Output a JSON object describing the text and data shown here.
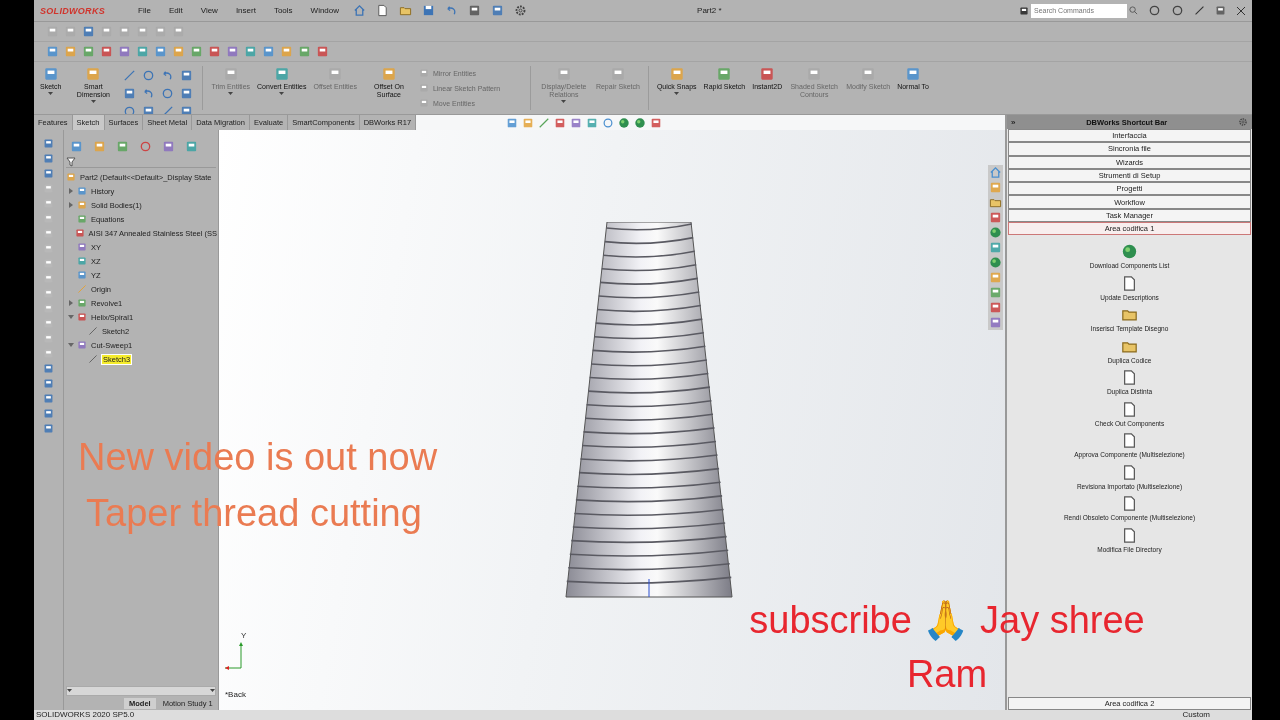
{
  "app": {
    "logo": "SOLIDWORKS",
    "menu": [
      "File",
      "Edit",
      "View",
      "Insert",
      "Tools",
      "Window"
    ],
    "document_title": "Part2 *",
    "search": {
      "placeholder": "Search Commands"
    }
  },
  "commands": [
    {
      "kind": "button",
      "label": "Sketch",
      "disabled": false,
      "caret": true
    },
    {
      "kind": "button",
      "label": "Smart Dimension",
      "disabled": false,
      "caret": true
    },
    {
      "kind": "palette"
    },
    {
      "kind": "separator"
    },
    {
      "kind": "button",
      "label": "Trim Entities",
      "disabled": true,
      "caret": true
    },
    {
      "kind": "button",
      "label": "Convert Entities",
      "disabled": false,
      "caret": true
    },
    {
      "kind": "button",
      "label": "Offset Entities",
      "disabled": true,
      "caret": false
    },
    {
      "kind": "button",
      "label": "Offset On Surface",
      "disabled": false,
      "caret": false
    },
    {
      "kind": "list",
      "items": [
        {
          "label": "Mirror Entities",
          "disabled": true
        },
        {
          "label": "Linear Sketch Pattern",
          "disabled": true
        },
        {
          "label": "Move Entities",
          "disabled": true
        }
      ]
    },
    {
      "kind": "separator"
    },
    {
      "kind": "button",
      "label": "Display/Delete Relations",
      "disabled": true,
      "caret": true
    },
    {
      "kind": "button",
      "label": "Repair Sketch",
      "disabled": true,
      "caret": false
    },
    {
      "kind": "separator"
    },
    {
      "kind": "button",
      "label": "Quick Snaps",
      "disabled": false,
      "caret": true
    },
    {
      "kind": "button",
      "label": "Rapid Sketch",
      "disabled": false,
      "caret": false
    },
    {
      "kind": "button",
      "label": "Instant2D",
      "disabled": false,
      "caret": false
    },
    {
      "kind": "button",
      "label": "Shaded Sketch Contours",
      "disabled": true,
      "caret": false
    },
    {
      "kind": "button",
      "label": "Modify Sketch",
      "disabled": true,
      "caret": false
    },
    {
      "kind": "button",
      "label": "Normal To",
      "disabled": false,
      "caret": false
    }
  ],
  "tabs": [
    {
      "label": "Features",
      "selected": false
    },
    {
      "label": "Sketch",
      "selected": true
    },
    {
      "label": "Surfaces",
      "selected": false
    },
    {
      "label": "Sheet Metal",
      "selected": false
    },
    {
      "label": "Data Migration",
      "selected": false
    },
    {
      "label": "Evaluate",
      "selected": false
    },
    {
      "label": "SmartComponents",
      "selected": false
    },
    {
      "label": "DBWorks R17",
      "selected": false
    }
  ],
  "tree": {
    "root": "Part2  (Default<<Default>_Display State",
    "nodes": [
      {
        "label": "History",
        "kind": "branch",
        "expanded": false,
        "selected": false
      },
      {
        "label": "Solid Bodies(1)",
        "kind": "branch",
        "expanded": false,
        "selected": false
      },
      {
        "label": "Equations",
        "kind": "leaf",
        "selected": false
      },
      {
        "label": "AISI 347 Annealed Stainless Steel (SS",
        "kind": "leaf",
        "selected": false
      },
      {
        "label": "XY",
        "kind": "leaf",
        "selected": false
      },
      {
        "label": "XZ",
        "kind": "leaf",
        "selected": false
      },
      {
        "label": "YZ",
        "kind": "leaf",
        "selected": false
      },
      {
        "label": "Origin",
        "kind": "leaf",
        "selected": false
      },
      {
        "label": "Revolve1",
        "kind": "branch",
        "expanded": false,
        "selected": false
      },
      {
        "label": "Helix/Spiral1",
        "kind": "branch",
        "expanded": true,
        "selected": false,
        "children": [
          {
            "label": "Sketch2",
            "kind": "leaf",
            "selected": false
          }
        ]
      },
      {
        "label": "Cut-Sweep1",
        "kind": "branch",
        "expanded": true,
        "selected": false,
        "children": [
          {
            "label": "Sketch3",
            "kind": "leaf",
            "selected": true
          }
        ]
      }
    ]
  },
  "bottom_tabs": [
    {
      "label": "Model",
      "selected": true
    },
    {
      "label": "Motion Study 1",
      "selected": false
    }
  ],
  "viewport": {
    "view_label": "*Back",
    "triad_label": "Y"
  },
  "overlay": {
    "announcement": [
      "New video is out now",
      "Taper thread cutting"
    ],
    "subscribe": "subscribe 🙏 Jay shree Ram"
  },
  "task_pane": {
    "expand_glyph": "»",
    "title": "DBWorks Shortcut Bar",
    "sections": [
      {
        "label": "Interfaccia",
        "selected": false
      },
      {
        "label": "Sincronia file",
        "selected": false
      },
      {
        "label": "Wizards",
        "selected": false
      },
      {
        "label": "Strumenti di Setup",
        "selected": false
      },
      {
        "label": "Progetti",
        "selected": false
      },
      {
        "label": "Workflow",
        "selected": false
      },
      {
        "label": "Task Manager",
        "selected": false
      },
      {
        "label": "Area codifica 1",
        "selected": true
      }
    ],
    "tools": [
      "Download Components List",
      "Update Descriptions",
      "Inserisci Template Disegno",
      "Duplica Codice",
      "Duplica Distinta",
      "Check Out Components",
      "Approva Componente (Multiselezione)",
      "Revisiona Importato (Multiselezione)",
      "Rendi Obsoleto Componente (Multiselezione)",
      "Modifica File Directory"
    ],
    "footer_section": "Area codifica 2"
  },
  "status_bar": {
    "version": "SOLIDWORKS 2020 SP5.0",
    "units": "Custom"
  }
}
